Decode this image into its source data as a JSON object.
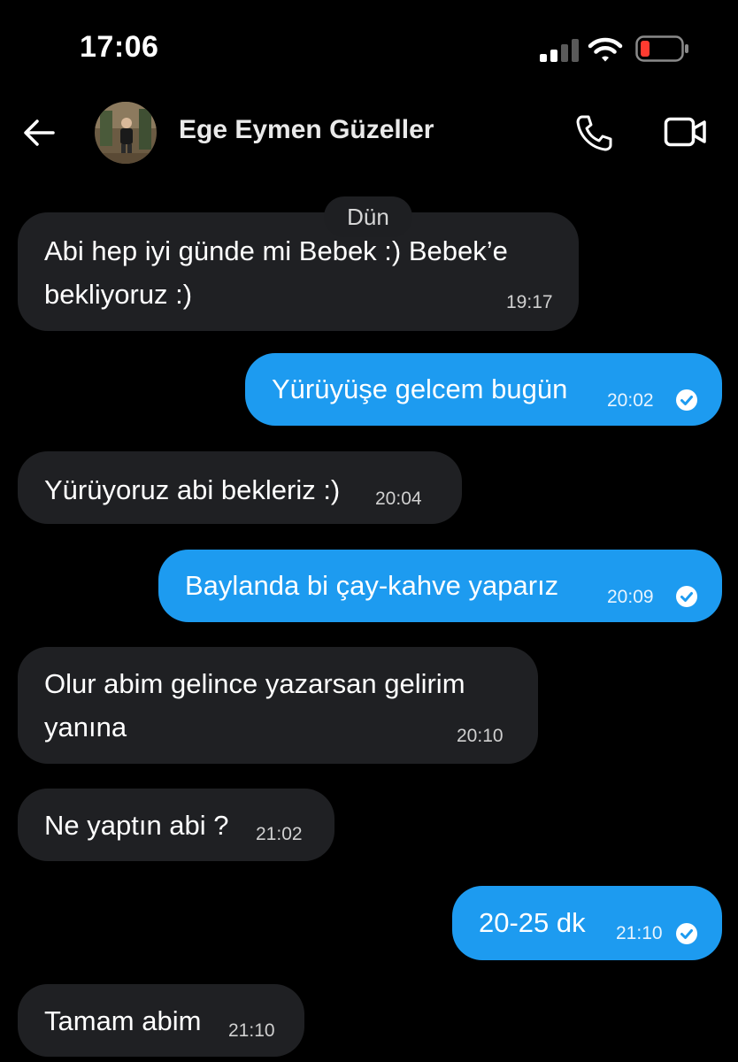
{
  "status_bar": {
    "time": "17:06"
  },
  "header": {
    "contact_name": "Ege Eymen Güzeller"
  },
  "date_separator": "Dün",
  "messages": [
    {
      "direction": "in",
      "lines": [
        "Abi hep iyi günde mi Bebek :) Bebek’e",
        "bekliyoruz :)"
      ],
      "time": "19:17"
    },
    {
      "direction": "out",
      "lines": [
        "Yürüyüşe gelcem bugün"
      ],
      "time": "20:02",
      "status": "check-icon"
    },
    {
      "direction": "in",
      "lines": [
        "Yürüyoruz abi bekleriz :)"
      ],
      "time": "20:04"
    },
    {
      "direction": "out",
      "lines": [
        "Baylanda bi çay-kahve yaparız"
      ],
      "time": "20:09",
      "status": "check-icon"
    },
    {
      "direction": "in",
      "lines": [
        "Olur abim gelince yazarsan gelirim",
        "yanına"
      ],
      "time": "20:10"
    },
    {
      "direction": "in",
      "lines": [
        "Ne yaptın abi ?"
      ],
      "time": "21:02"
    },
    {
      "direction": "out",
      "lines": [
        "20-25 dk"
      ],
      "time": "21:10",
      "status": "check-icon"
    },
    {
      "direction": "in",
      "lines": [
        "Tamam abim"
      ],
      "time": "21:10"
    }
  ],
  "colors": {
    "background": "#000000",
    "incoming_bubble": "#1f2023",
    "outgoing_bubble": "#1d9bf0",
    "battery_low": "#ff3b30"
  }
}
